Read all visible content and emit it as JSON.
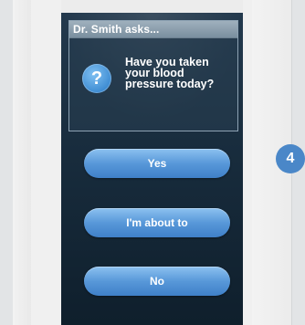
{
  "dialog": {
    "title": "Dr. Smith asks...",
    "icon": "question-icon",
    "icon_glyph": "?",
    "question_lines": [
      "Have you taken",
      "your blood",
      "pressure today?"
    ]
  },
  "buttons": {
    "yes": "Yes",
    "about_to": "I'm about to",
    "no": "No"
  },
  "step_badge": "4",
  "colors": {
    "screen_bg": "#182c3d",
    "button_blue": "#5898d9",
    "badge_blue": "#4a87c8"
  }
}
